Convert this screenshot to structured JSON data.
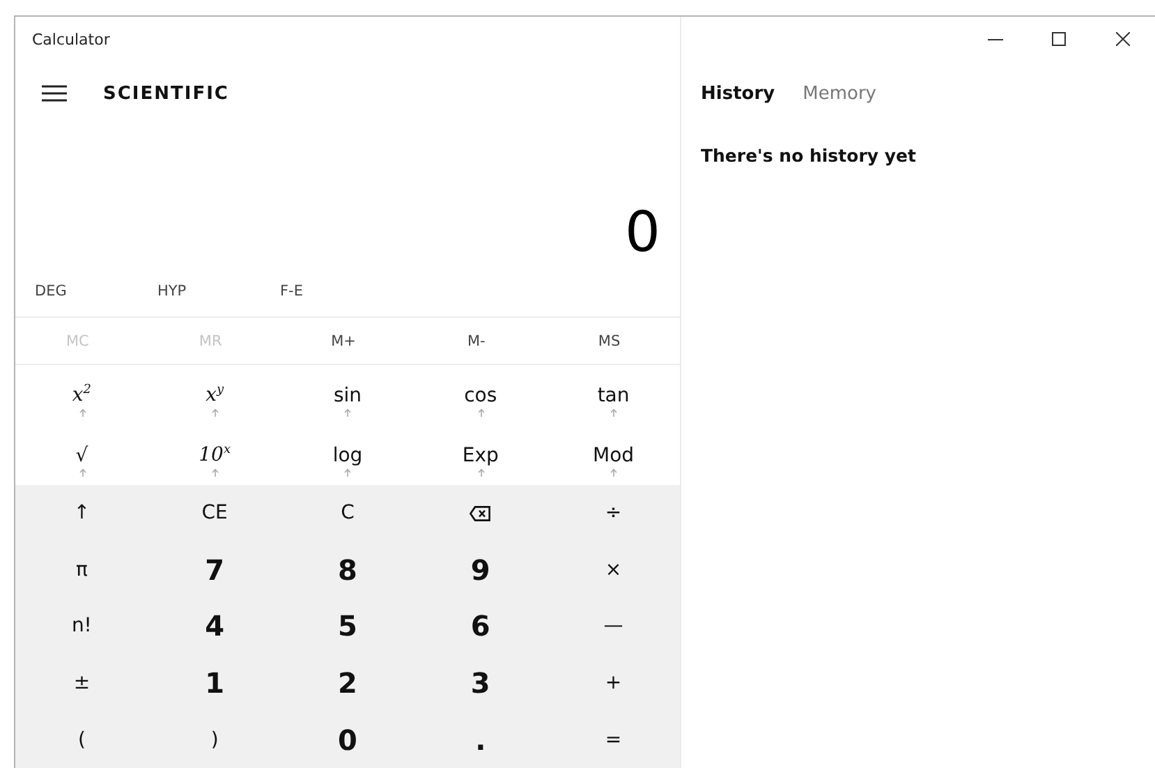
{
  "window": {
    "title": "Calculator",
    "controls": [
      {
        "kind": "minimize"
      },
      {
        "kind": "maximize"
      },
      {
        "kind": "close"
      }
    ]
  },
  "header": {
    "title": "SCIENTIFIC"
  },
  "display": {
    "value": "0"
  },
  "modes": [
    "DEG",
    "HYP",
    "F-E"
  ],
  "memory": [
    {
      "label": "MC",
      "disabled": true
    },
    {
      "label": "MR",
      "disabled": true
    },
    {
      "label": "M+",
      "disabled": false
    },
    {
      "label": "M-",
      "disabled": false
    },
    {
      "label": "MS",
      "disabled": false
    }
  ],
  "keys": [
    {
      "label": "x$^{2}$",
      "kind": "function"
    },
    {
      "label": "x$^{y}$",
      "kind": "function"
    },
    {
      "label": "sin",
      "kind": "function"
    },
    {
      "label": "cos",
      "kind": "function"
    },
    {
      "label": "tan",
      "kind": "function"
    },
    {
      "label": "√",
      "kind": "function"
    },
    {
      "label": "10$^{x}$",
      "kind": "function"
    },
    {
      "label": "log",
      "kind": "function"
    },
    {
      "label": "Exp",
      "kind": "function"
    },
    {
      "label": "Mod",
      "kind": "function"
    },
    {
      "label": "↑",
      "kind": "operator"
    },
    {
      "label": "CE",
      "kind": "operator"
    },
    {
      "label": "C",
      "kind": "operator"
    },
    {
      "kind": "backspace"
    },
    {
      "label": "÷",
      "kind": "operator"
    },
    {
      "label": "π",
      "kind": "operator"
    },
    {
      "label": "7",
      "kind": "digit"
    },
    {
      "label": "8",
      "kind": "digit"
    },
    {
      "label": "9",
      "kind": "digit"
    },
    {
      "label": "×",
      "kind": "operator"
    },
    {
      "label": "n!",
      "kind": "operator"
    },
    {
      "label": "4",
      "kind": "digit"
    },
    {
      "label": "5",
      "kind": "digit"
    },
    {
      "label": "6",
      "kind": "digit"
    },
    {
      "label": "—",
      "kind": "operator"
    },
    {
      "label": "±",
      "kind": "operator"
    },
    {
      "label": "1",
      "kind": "digit"
    },
    {
      "label": "2",
      "kind": "digit"
    },
    {
      "label": "3",
      "kind": "digit"
    },
    {
      "label": "+",
      "kind": "operator"
    },
    {
      "label": "(",
      "kind": "operator"
    },
    {
      "label": ")",
      "kind": "operator"
    },
    {
      "label": "0",
      "kind": "digit"
    },
    {
      "label": ".",
      "kind": "digit"
    },
    {
      "label": "=",
      "kind": "operator"
    }
  ],
  "side_tabs": [
    {
      "label": "History",
      "selected": true
    },
    {
      "label": "Memory",
      "selected": false
    }
  ],
  "history": {
    "empty_message": "There's no history yet"
  }
}
